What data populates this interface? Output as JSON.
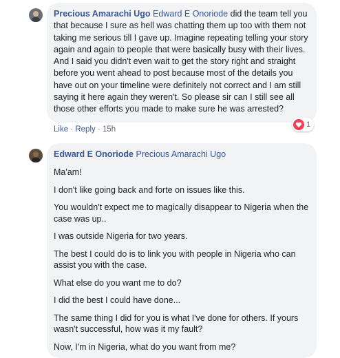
{
  "comment1": {
    "author": "Precious Amarachi Ugo",
    "mention": "Edward E Onoriode",
    "text": " did the team tell you that because I sure as hell was chatting them up too with them not taking me serious till I gave up. Imagine repeating telling your story again and again to people that were basically busy with their lives. And I said you didn't even wait to get the story right and straight before you went ahead to post because most of the details you have out on your timeline were definitely not correct and I am still saying it here again they weren't. So please sir can I still see all those other efforts you made to make sure he was arrested?",
    "actions": {
      "like": "Like",
      "reply": "Reply",
      "time": "15h"
    },
    "reaction_count": "1",
    "reaction_color": "#f33e58"
  },
  "comment2": {
    "author": "Edward E Onoriode",
    "mention": "Precious Amarachi Ugo",
    "paragraphs": [
      "Ma'am!",
      "I don't like going back and forte on issues like this.",
      "You wouldn't expect me to magically disappear to Nigeria when the case was up..",
      "I was outside Nigeria for two years.",
      "The best I could do is to link you with people in Nigeria who can assist you with the case.",
      "What else do you want me to do?",
      "I did the best I could have done...",
      "The same thing I did for you is what I've done for others. If yours wasn't successful, how was it my fault?",
      "Now, I'm in Nigeria, what do you want from me?"
    ]
  },
  "colors": {
    "bubble": "#f2f3f5",
    "link": "#385898",
    "meta": "#606770"
  }
}
